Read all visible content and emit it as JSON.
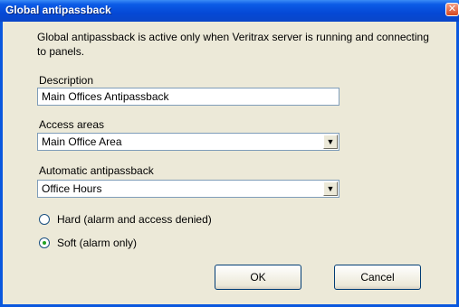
{
  "window": {
    "title": "Global antipassback",
    "close_glyph": "✕"
  },
  "info_text": "Global antipassback is active only when Veritrax server is running and connecting to panels.",
  "description": {
    "label": "Description",
    "value": "Main Offices Antipassback"
  },
  "access_areas": {
    "label": "Access areas",
    "selected": "Main Office Area"
  },
  "automatic_antipassback": {
    "label": "Automatic antipassback",
    "selected": "Office Hours"
  },
  "mode_options": [
    {
      "label": "Hard (alarm and access denied)",
      "checked": false
    },
    {
      "label": "Soft (alarm only)",
      "checked": true
    }
  ],
  "buttons": {
    "ok": "OK",
    "cancel": "Cancel"
  },
  "icons": {
    "close": "close-icon",
    "dropdown": "chevron-down-icon"
  },
  "colors": {
    "titlebar": "#0549d6",
    "dialog_bg": "#ece9d8",
    "close_button": "#d7461e"
  }
}
